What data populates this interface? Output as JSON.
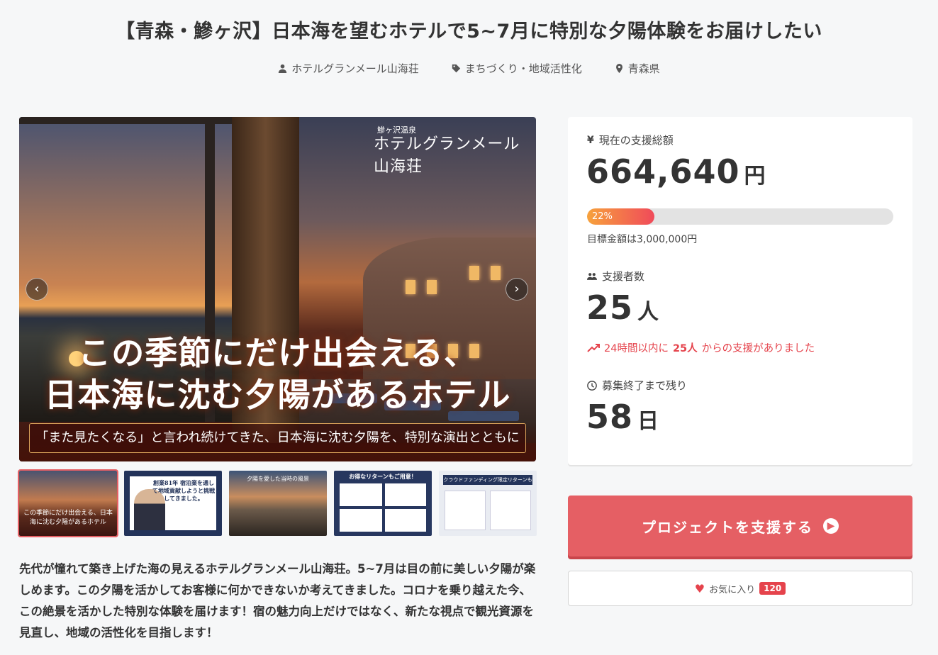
{
  "project": {
    "title": "【青森・鰺ヶ沢】日本海を望むホテルで5~7月に特別な夕陽体験をお届けしたい",
    "owner": "ホテルグランメール山海荘",
    "category": "まちづくり・地域活性化",
    "location": "青森県"
  },
  "hero": {
    "logo_sub": "鰺ヶ沢温泉",
    "logo": "ホテルグランメール山海荘",
    "headline_line1": "この季節にだけ出会える、",
    "headline_line2": "日本海に沈む夕陽があるホテル",
    "band": "「また見たくなる」と言われ続けてきた、日本海に沈む夕陽を、特別な演出とともに",
    "prev_label": "‹",
    "next_label": "›"
  },
  "thumbnails": {
    "t1_caption": "この季節にだけ出会える、日本海に沈む夕陽があるホテル",
    "t2_caption": "創業81年 宿泊業を通して地域貢献しようと挑戦してきました。",
    "t3_caption": "夕陽を愛した当時の風景",
    "t4_caption": "お得なリターンもご用意！",
    "t5_caption": "クラウドファンディング限定リターンも"
  },
  "description": "先代が憧れて築き上げた海の見えるホテルグランメール山海荘。5~7月は目の前に美しい夕陽が楽しめます。この夕陽を活かしてお客様に何かできないか考えてきました。コロナを乗り越えた今、この絶景を活かした特別な体験を届けます！宿の魅力向上だけではなく、新たな視点で観光資源を見直し、地域の活性化を目指します！",
  "stats": {
    "amount_label": "現在の支援総額",
    "amount": "664,640",
    "amount_unit": "円",
    "progress_percent": 22,
    "progress_text": "22%",
    "goal_text": "目標金額は3,000,000円",
    "supporters_label": "支援者数",
    "supporters": "25",
    "supporters_unit": "人",
    "recent_prefix": "24時間以内に",
    "recent_count": "25人",
    "recent_suffix": "からの支援がありました",
    "remaining_label": "募集終了まで残り",
    "remaining": "58",
    "remaining_unit": "日"
  },
  "actions": {
    "support_label": "プロジェクトを支援する",
    "favorite_label": "お気に入り",
    "favorite_count": "120"
  },
  "colors": {
    "accent": "#e55f64",
    "alert": "#e5434c",
    "background": "#f6f7f8"
  },
  "icons": {
    "owner": "user-icon",
    "category": "tag-icon",
    "location": "map-pin-icon",
    "amount": "yen-icon",
    "supporters": "users-icon",
    "recent": "trending-up-icon",
    "remaining": "clock-icon",
    "support": "arrow-circle-right-icon",
    "favorite": "heart-icon"
  }
}
